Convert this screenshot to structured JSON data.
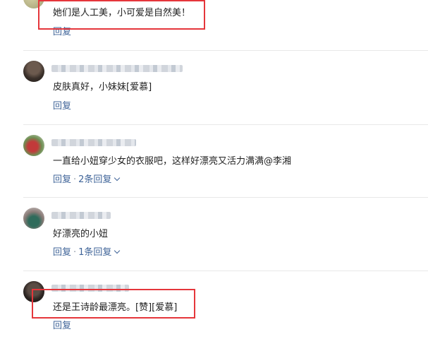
{
  "comments": [
    {
      "text": "她们是人工美，小可爱是自然美！",
      "reply_label": "回复"
    },
    {
      "text": "皮肤真好，小妹妹[爱慕]",
      "reply_label": "回复"
    },
    {
      "text": "一直给小妞穿少女的衣服吧，这样好漂亮又活力满满@李湘",
      "reply_label": "回复",
      "separator": "·",
      "replies_label": "2条回复"
    },
    {
      "text": "好漂亮的小妞",
      "reply_label": "回复",
      "separator": "·",
      "replies_label": "1条回复"
    },
    {
      "text": "还是王诗龄最漂亮。[赞][爱慕]",
      "reply_label": "回复"
    }
  ],
  "colors": {
    "link": "#406599",
    "highlight": "#e5363b",
    "divider": "#e8e8e8"
  },
  "icons": {
    "expand": "chevron-down-icon"
  }
}
